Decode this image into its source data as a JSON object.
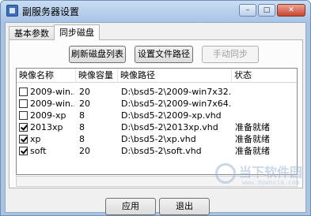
{
  "window": {
    "title": "副服务器设置"
  },
  "tabs": [
    {
      "label": "基本参数",
      "active": false
    },
    {
      "label": "同步磁盘",
      "active": true
    }
  ],
  "toolbar": {
    "refresh": "刷新磁盘列表",
    "set_path": "设置文件路径",
    "manual_sync": "手动同步"
  },
  "table": {
    "headers": [
      "映像名称",
      "映像容量",
      "映像路径",
      "状态"
    ],
    "rows": [
      {
        "checked": false,
        "name": "2009-win...",
        "size": "20",
        "path": "D:\\bsd5-2\\2009-win7x32....",
        "status": ""
      },
      {
        "checked": false,
        "name": "2009-win...",
        "size": "20",
        "path": "D:\\bsd5-2\\2009-win7x64....",
        "status": ""
      },
      {
        "checked": false,
        "name": "2009-xp",
        "size": "8",
        "path": "D:\\bsd5-2\\2009-xp.vhd",
        "status": ""
      },
      {
        "checked": true,
        "name": "2013xp",
        "size": "8",
        "path": "D:\\bsd5-2\\2013xp.vhd",
        "status": "准备就绪"
      },
      {
        "checked": true,
        "name": "xp",
        "size": "8",
        "path": "D:\\bsd5-2\\xp.vhd",
        "status": "准备就绪"
      },
      {
        "checked": true,
        "name": "soft",
        "size": "20",
        "path": "D:\\bsd5-2\\soft.vhd",
        "status": "准备就绪"
      }
    ]
  },
  "footer": {
    "apply": "应用",
    "exit": "退出"
  },
  "watermark": {
    "text": "当下软件园",
    "url": "www.downxia.com"
  }
}
